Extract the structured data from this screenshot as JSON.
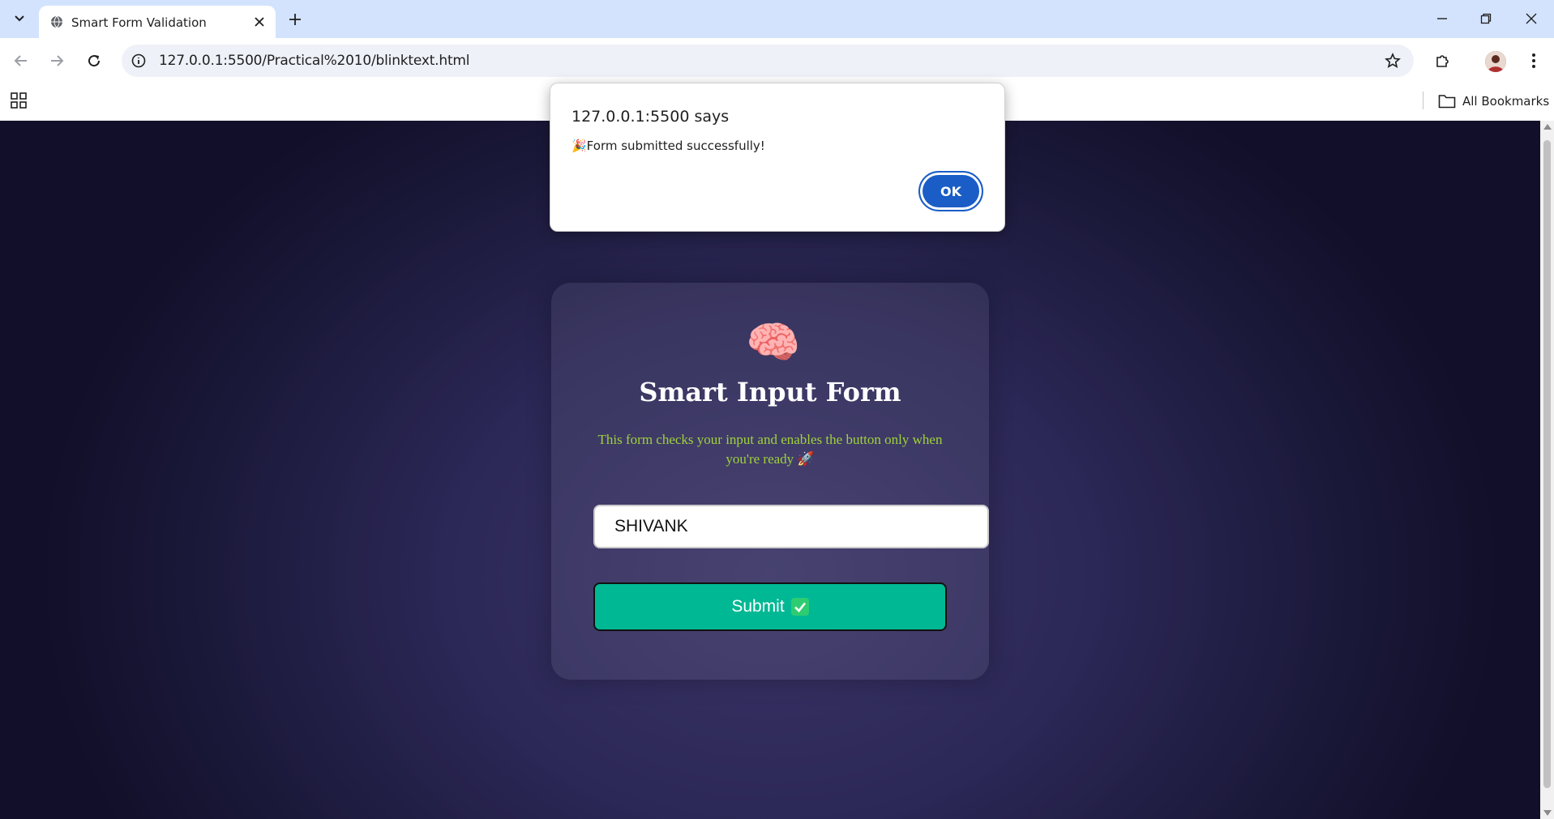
{
  "browser": {
    "tab_title": "Smart Form Validation",
    "url": "127.0.0.1:5500/Practical%2010/blinktext.html",
    "all_bookmarks_label": "All Bookmarks"
  },
  "alert": {
    "title": "127.0.0.1:5500 says",
    "message": "🎉Form submitted successfully!",
    "ok_label": "OK"
  },
  "form": {
    "icon": "🧠",
    "title": "Smart Input Form",
    "description": "This form checks your input and enables the button only when you're ready 🚀",
    "input_value": "SHIVANK",
    "submit_label": "Submit"
  },
  "colors": {
    "accent_button": "#00b894",
    "description_text": "#9fd33a",
    "alert_ok": "#1a5dc6"
  }
}
